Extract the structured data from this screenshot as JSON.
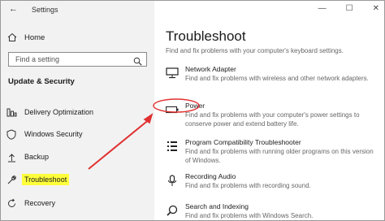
{
  "window": {
    "app_title": "Settings",
    "controls": [
      "—",
      "☐",
      "✕"
    ]
  },
  "sidebar": {
    "home_label": "Home",
    "search_placeholder": "Find a setting",
    "section_title": "Update & Security",
    "items": [
      {
        "label": "Delivery Optimization",
        "icon": "delivery-optimization-icon"
      },
      {
        "label": "Windows Security",
        "icon": "shield-icon"
      },
      {
        "label": "Backup",
        "icon": "backup-icon"
      },
      {
        "label": "Troubleshoot",
        "icon": "wrench-icon",
        "selected": true,
        "highlight_color": "#ffff3b"
      },
      {
        "label": "Recovery",
        "icon": "recovery-icon"
      }
    ]
  },
  "main": {
    "title": "Troubleshoot",
    "top_desc": "Find and fix problems with your computer's keyboard settings.",
    "items": [
      {
        "title": "Network Adapter",
        "desc": "Find and fix problems with wireless and other network adapters.",
        "icon": "network-adapter-icon"
      },
      {
        "title": "Power",
        "desc": "Find and fix problems with your computer's power settings to conserve power and extend battery life.",
        "icon": "battery-icon"
      },
      {
        "title": "Program Compatibility Troubleshooter",
        "desc": "Find and fix problems with running older programs on this version of Windows.",
        "icon": "program-compatibility-icon"
      },
      {
        "title": "Recording Audio",
        "desc": "Find and fix problems with recording sound.",
        "icon": "microphone-icon"
      },
      {
        "title": "Search and Indexing",
        "desc": "Find and fix problems with Windows Search.",
        "icon": "search-indexing-icon"
      }
    ]
  },
  "annotation": {
    "arrow_color": "#e03030"
  }
}
